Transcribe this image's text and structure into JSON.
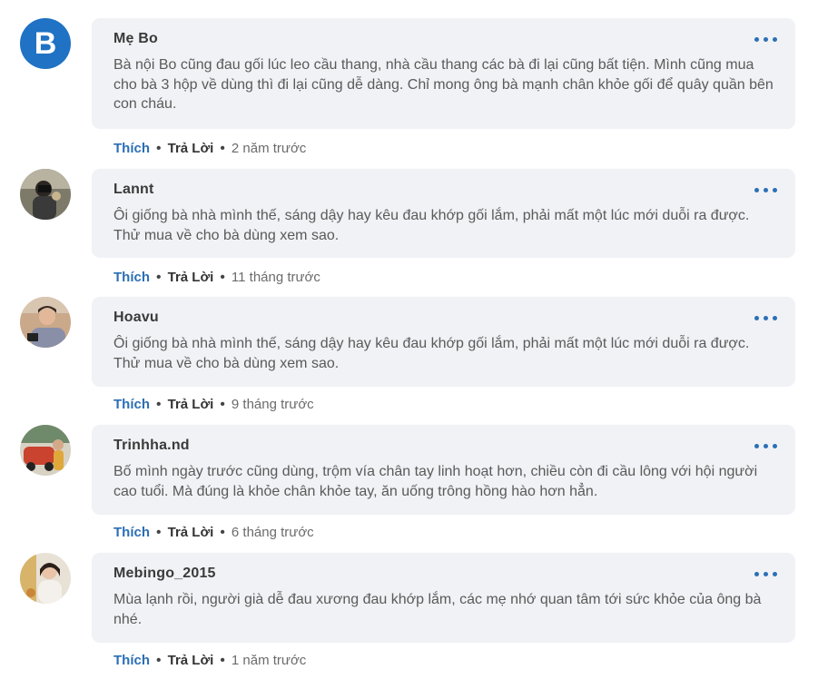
{
  "comments": [
    {
      "avatar_letter": "B",
      "author": "Mẹ Bo",
      "text": "Bà nội Bo cũng đau gối lúc leo cầu thang, nhà cầu thang các bà đi lại cũng bất tiện. Mình cũng mua cho bà 3 hộp về dùng thì đi lại cũng dễ dàng. Chỉ mong ông bà mạnh chân khỏe gối để quây quần bên con cháu.",
      "like_label": "Thích",
      "reply_label": "Trả Lời",
      "separator": "•",
      "time": "2 năm trước"
    },
    {
      "author": "Lannt",
      "text": "Ôi giống bà nhà mình thế, sáng dậy hay kêu đau khớp gối lắm, phải mất một lúc mới duỗi ra được. Thử mua về cho bà dùng xem sao.",
      "like_label": "Thích",
      "reply_label": "Trả Lời",
      "separator": "•",
      "time": "11 tháng trước"
    },
    {
      "author": "Hoavu",
      "text": "Ôi giống bà nhà mình thế, sáng dậy hay kêu đau khớp gối lắm, phải mất một lúc mới duỗi ra được. Thử mua về cho bà dùng xem sao.",
      "like_label": "Thích",
      "reply_label": "Trả Lời",
      "separator": "•",
      "time": "9 tháng trước"
    },
    {
      "author": "Trinhha.nd",
      "text": "Bố mình ngày trước cũng dùng, trộm vía chân tay linh hoạt hơn, chiều còn đi cầu lông với hội người cao tuổi. Mà đúng là khỏe chân khỏe tay, ăn uống trông hồng hào hơn hẳn.",
      "like_label": "Thích",
      "reply_label": "Trả Lời",
      "separator": "•",
      "time": "6 tháng trước"
    },
    {
      "author": "Mebingo_2015",
      "text": "Mùa lạnh rồi, người già dễ đau xương đau khớp lắm, các mẹ nhớ quan tâm tới sức khỏe của ông bà nhé.",
      "like_label": "Thích",
      "reply_label": "Trả Lời",
      "separator": "•",
      "time": "1 năm trước"
    }
  ],
  "colors": {
    "accent": "#2a6fb6",
    "avatar_blue": "#1f72c4",
    "bubble": "#f0f2f5"
  },
  "icons": {
    "more": "more-horizontal-icon"
  }
}
